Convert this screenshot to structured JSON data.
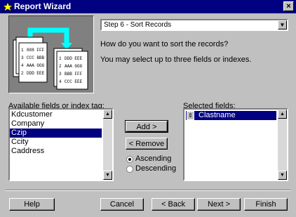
{
  "window": {
    "title": "Report Wizard",
    "close_glyph": "×"
  },
  "step": {
    "value": "Step 6 - Sort Records",
    "dropdown_glyph": "▼"
  },
  "instructions": {
    "line1": "How do you want to sort the records?",
    "line2": "You may select up to three fields or indexes."
  },
  "available": {
    "label": "Available fields or index tag:",
    "items": [
      "Kdcustomer",
      "Company",
      "Czip",
      "Ccity",
      "Caddress"
    ],
    "selected_index": 2
  },
  "selected": {
    "label": "Selected fields:",
    "items": [
      "Clastname"
    ]
  },
  "buttons": {
    "add": "Add >",
    "remove": "< Remove",
    "help": "Help",
    "cancel": "Cancel",
    "back": "< Back",
    "next": "Next >",
    "finish": "Finish"
  },
  "sort_order": {
    "ascending": "Ascending",
    "descending": "Descending",
    "value": "Ascending"
  },
  "illustration": {
    "rows_left": [
      [
        "1",
        "888 FFF"
      ],
      [
        "3",
        "CCC BBB"
      ],
      [
        "4",
        "AAA GGG"
      ],
      [
        "2",
        "DDD EEE"
      ]
    ],
    "rows_right": [
      [
        "1",
        "DDD EEE"
      ],
      [
        "2",
        "AAA GGG"
      ],
      [
        "3",
        "BBB FFF"
      ],
      [
        "4",
        "CCC EEE"
      ]
    ]
  },
  "colors": {
    "titlebar": "#000080",
    "accent": "#00ffff",
    "face": "#c0c0c0"
  }
}
